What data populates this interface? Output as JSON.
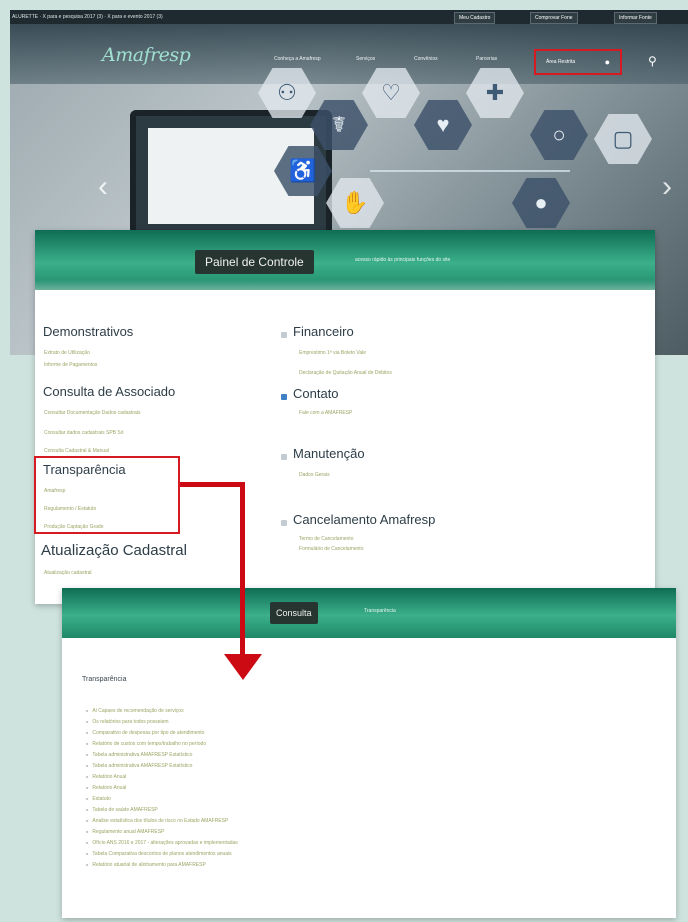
{
  "site": {
    "topbar_left": "ALURETTE  ·  X para e pesquisa 2017 (3)  ·  X para e evento 2017 (3)",
    "topbar_links": [
      "Meu Cadastro",
      "Comprovar Fone",
      "Informar Fonte"
    ],
    "logo": "Amafresp",
    "nav": [
      "Conheça a Amafresp",
      "Serviços",
      "Convênios",
      "Parcerias"
    ],
    "area_button": "Área Restrita",
    "area_icon": "person-icon",
    "search_icon": "search-icon",
    "hex_icons": [
      "⚕",
      "♡",
      "✚",
      "♿",
      "☤",
      "▢",
      "●"
    ]
  },
  "panel": {
    "title": "Painel de Controle",
    "subtitle": "acesso rápido às principais funções do site",
    "sections_left": [
      {
        "title": "Demonstrativos",
        "links": [
          "Extrato de Utilização",
          "Informe de Pagamentos"
        ]
      },
      {
        "title": "Consulta de Associado",
        "links": [
          "Consultar Documentação Dados cadastrais",
          "Consultar dados cadastrais SPB Só",
          "Consulta Cadastral & Manual"
        ]
      },
      {
        "title": "Transparência",
        "links": [
          "Amafresp",
          "Regulamento / Estatuto",
          "Produção Captação Grade"
        ]
      },
      {
        "title": "Atualização Cadastral",
        "links": [
          "Atualização cadastral"
        ]
      }
    ],
    "sections_right": [
      {
        "title": "Financeiro",
        "links": [
          "Emprestimo 1ª via Boleto Vale",
          "Declaração de Quitação Anual de Débitos"
        ]
      },
      {
        "title": "Contato",
        "links": [
          "Fale com a AMAFRESP"
        ]
      },
      {
        "title": "Manutenção",
        "links": [
          "Dados Gerais"
        ]
      },
      {
        "title": "Cancelamento Amafresp",
        "links": [
          "Termo de Cancelamento",
          "Formulário de Cancelamento"
        ]
      }
    ]
  },
  "consulta": {
    "title": "Consulta",
    "subtitle": "Transparência",
    "heading": "Transparência",
    "items": [
      "Ai Capaes de recomendação de serviços",
      "Os relatórios para todos posseiem",
      "Comparativo de despesas por tipo de atendimento",
      "Relatório de custos com tempo/trabalho no período",
      "Tabela administrativa AMAFRESP Estatístico",
      "Tabela administrativa AMAFRESP Estatístico",
      "Relatório Anual",
      "Relatório Anual",
      "Estatuto",
      "Tabela de saúde AMAFRESP",
      "Analise estatística dos títulos de risco no Estado AMAFRESP",
      "Regulamento anual AMAFRESP",
      "Ofício ANS 2016 e 2017 - alterações aprovadas e implementadas",
      "Tabela Comparativa descontos de planos atendimentos anuais",
      "Relatório atuarial de alinhamento para AMAFRESP"
    ]
  }
}
